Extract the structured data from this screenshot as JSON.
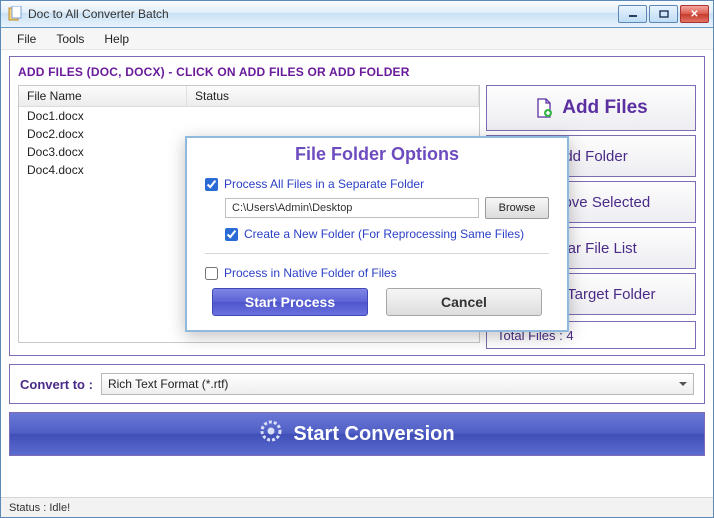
{
  "window": {
    "title": "Doc to All Converter Batch"
  },
  "menu": {
    "file": "File",
    "tools": "Tools",
    "help": "Help"
  },
  "heading": "ADD FILES (DOC, DOCX) - CLICK ON ADD FILES OR ADD FOLDER",
  "columns": {
    "name": "File Name",
    "status": "Status"
  },
  "files": [
    "Doc1.docx",
    "Doc2.docx",
    "Doc3.docx",
    "Doc4.docx"
  ],
  "buttons": {
    "addFiles": "Add Files",
    "addFolder": "Add Folder",
    "removeSelected": "Remove Selected",
    "clearFileList": "Clear File List",
    "openTarget": "Open Target Folder"
  },
  "totalFiles": "Total Files : 4",
  "convert": {
    "label": "Convert to :",
    "value": "Rich Text Format (*.rtf)"
  },
  "startConversion": "Start Conversion",
  "status": "Status :  Idle!",
  "dialog": {
    "title": "File Folder Options",
    "opt1": "Process All Files in a Separate Folder",
    "path": "C:\\Users\\Admin\\Desktop",
    "browse": "Browse",
    "opt2": "Create a New Folder (For Reprocessing Same Files)",
    "opt3": "Process in Native Folder of Files",
    "start": "Start Process",
    "cancel": "Cancel"
  }
}
